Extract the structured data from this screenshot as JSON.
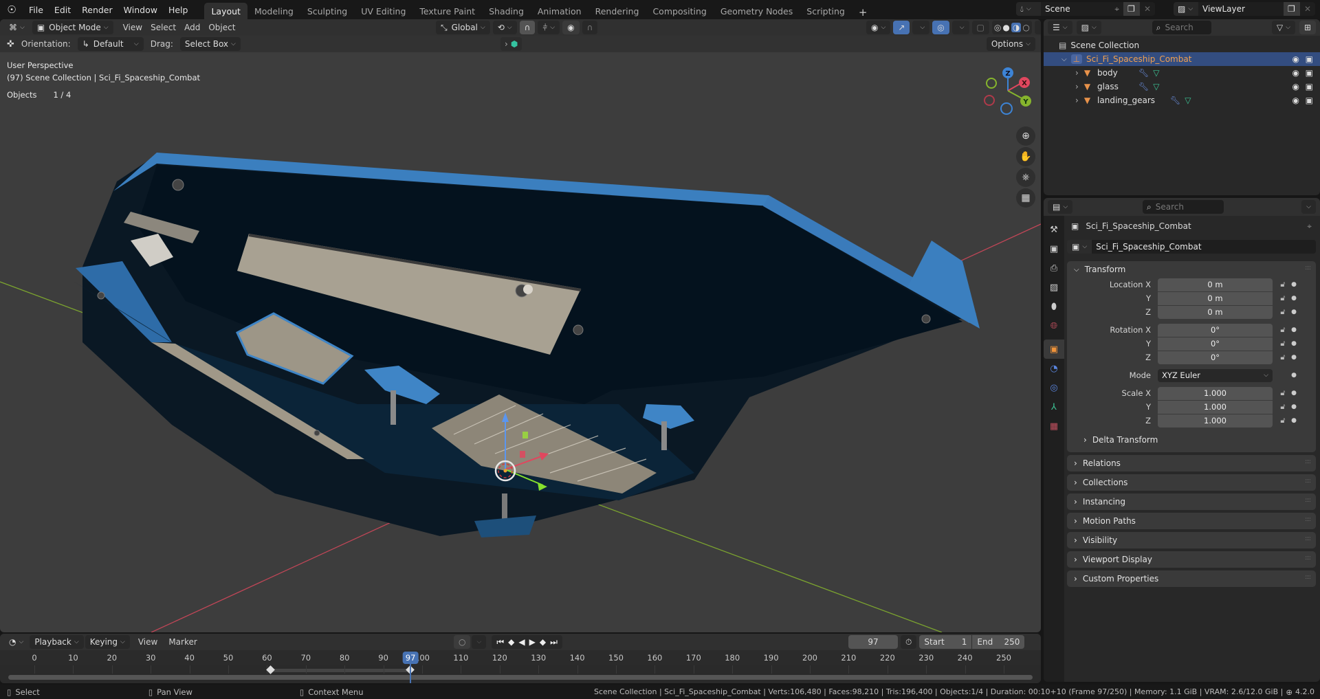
{
  "app": {
    "name": "Blender",
    "version": "4.2.0"
  },
  "topbar": {
    "menus": [
      "File",
      "Edit",
      "Render",
      "Window",
      "Help"
    ],
    "workspaces": [
      {
        "label": "Layout",
        "active": true
      },
      {
        "label": "Modeling"
      },
      {
        "label": "Sculpting"
      },
      {
        "label": "UV Editing"
      },
      {
        "label": "Texture Paint"
      },
      {
        "label": "Shading"
      },
      {
        "label": "Animation"
      },
      {
        "label": "Rendering"
      },
      {
        "label": "Compositing"
      },
      {
        "label": "Geometry Nodes"
      },
      {
        "label": "Scripting"
      }
    ],
    "add_workspace": "+",
    "scene": "Scene",
    "view_layer": "ViewLayer"
  },
  "viewport": {
    "mode": "Object Mode",
    "menus": [
      "View",
      "Select",
      "Add",
      "Object"
    ],
    "transform_orientation": "Global",
    "orientation_label": "Orientation:",
    "orientation_value": "Default",
    "drag_label": "Drag:",
    "drag_value": "Select Box",
    "options_label": "Options",
    "info_line1": "User Perspective",
    "info_line2": "(97) Scene Collection | Sci_Fi_Spaceship_Combat",
    "stats_label": "Objects",
    "stats_value": "1 / 4",
    "gizmo_axes": [
      "X",
      "Y",
      "Z"
    ],
    "colors": {
      "x_axis": "#e0475e",
      "y_axis": "#86b52d",
      "z_axis": "#3d84d6",
      "bg": "#3d3d3d"
    }
  },
  "outliner": {
    "search_placeholder": "Search",
    "root": "Scene Collection",
    "collection": "Sci_Fi_Spaceship_Combat",
    "objects": [
      {
        "name": "body"
      },
      {
        "name": "glass"
      },
      {
        "name": "landing_gears"
      }
    ]
  },
  "properties": {
    "search_placeholder": "Search",
    "context_name": "Sci_Fi_Spaceship_Combat",
    "object_name": "Sci_Fi_Spaceship_Combat",
    "transform": {
      "title": "Transform",
      "location_label": "Location X",
      "location": [
        "0 m",
        "0 m",
        "0 m"
      ],
      "rotation_label": "Rotation X",
      "rotation": [
        "0°",
        "0°",
        "0°"
      ],
      "mode_label": "Mode",
      "mode_value": "XYZ Euler",
      "scale_label": "Scale X",
      "scale": [
        "1.000",
        "1.000",
        "1.000"
      ],
      "axis_y": "Y",
      "axis_z": "Z",
      "delta": "Delta Transform"
    },
    "panels": [
      "Relations",
      "Collections",
      "Instancing",
      "Motion Paths",
      "Visibility",
      "Viewport Display",
      "Custom Properties"
    ]
  },
  "timeline": {
    "menus": [
      "Playback",
      "Keying",
      "View",
      "Marker"
    ],
    "current_frame": "97",
    "start_label": "Start",
    "start": "1",
    "end_label": "End",
    "end": "250",
    "ticks": [
      "0",
      "10",
      "20",
      "30",
      "40",
      "50",
      "60",
      "70",
      "80",
      "90",
      "100",
      "110",
      "120",
      "130",
      "140",
      "150",
      "160",
      "170",
      "180",
      "190",
      "200",
      "210",
      "220",
      "230",
      "240",
      "250"
    ],
    "keyframes": [
      61,
      97
    ],
    "playhead_color": "#4772b3"
  },
  "statusbar": {
    "hints": [
      {
        "icon": "mouse-left-icon",
        "label": "Select"
      },
      {
        "icon": "mouse-middle-icon",
        "label": "Pan View"
      },
      {
        "icon": "mouse-right-icon",
        "label": "Context Menu"
      }
    ],
    "info": "Scene Collection | Sci_Fi_Spaceship_Combat | Verts:106,480 | Faces:98,210 | Tris:196,400 | Objects:1/4 | Duration: 00:10+10 (Frame 97/250) | Memory: 1.1 GiB | VRAM: 2.6/12.0 GiB |",
    "version": "4.2.0"
  }
}
